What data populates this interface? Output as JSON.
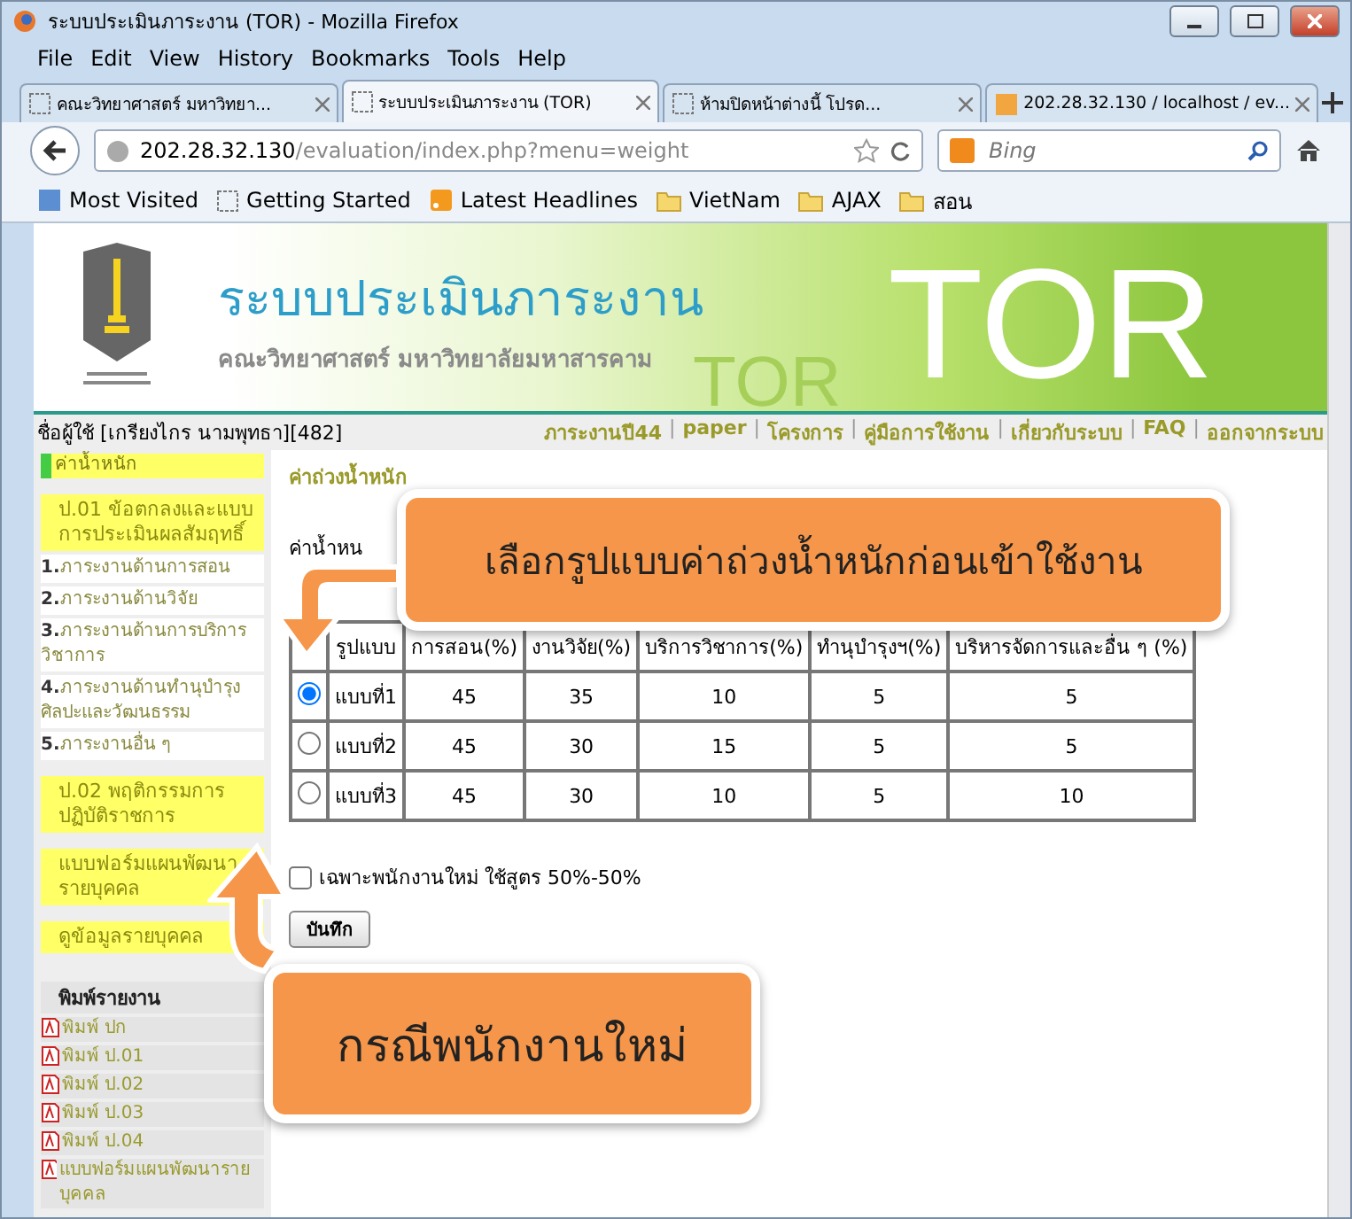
{
  "window": {
    "title": "ระบบประเมินภาระงาน (TOR) - Mozilla Firefox"
  },
  "menu": [
    "File",
    "Edit",
    "View",
    "History",
    "Bookmarks",
    "Tools",
    "Help"
  ],
  "tabs": [
    {
      "label": "คณะวิทยาศาสตร์ มหาวิทยา...",
      "selected": false,
      "kind": "page"
    },
    {
      "label": "ระบบประเมินภาระงาน (TOR)",
      "selected": true,
      "kind": "page"
    },
    {
      "label": "ห้ามปิดหน้าต่างนี้ โปรด...",
      "selected": false,
      "kind": "page"
    },
    {
      "label": "202.28.32.130 / localhost / ev...",
      "selected": false,
      "kind": "pma"
    }
  ],
  "address": {
    "host": "202.28.32.130",
    "path": "/evaluation/index.php?menu=weight"
  },
  "search": {
    "placeholder": "Bing"
  },
  "bookmarks": [
    {
      "label": "Most Visited",
      "kind": "star"
    },
    {
      "label": "Getting Started",
      "kind": "page"
    },
    {
      "label": "Latest Headlines",
      "kind": "feed"
    },
    {
      "label": "VietNam",
      "kind": "folder"
    },
    {
      "label": "AJAX",
      "kind": "folder"
    },
    {
      "label": "สอน",
      "kind": "folder"
    }
  ],
  "banner": {
    "title": "ระบบประเมินภาระงาน",
    "subtitle": "คณะวิทยาศาสตร์ มหาวิทยาลัยมหาสารคาม",
    "faint_text": "TOR",
    "big_text": "TOR"
  },
  "nav_separator": "|",
  "user_label": "ชื่อผู้ใช้ [เกรียงไกร นามพุทธา][482]",
  "nav_links": [
    "ภาระงานปี44",
    "paper",
    "โครงการ",
    "คู่มือการใช้งาน",
    "เกี่ยวกับระบบ",
    "FAQ",
    "ออกจากระบบ"
  ],
  "sidebar": [
    {
      "kind": "active",
      "label": "ค่าน้ำหนัก"
    },
    {
      "kind": "section",
      "label": "ป.01 ข้อตกลงและแบบการประเมินผลสัมฤทธิ์"
    },
    {
      "kind": "item",
      "number": "1.",
      "label": "ภาระงานด้านการสอน"
    },
    {
      "kind": "item",
      "number": "2.",
      "label": "ภาระงานด้านวิจัย"
    },
    {
      "kind": "item",
      "number": "3.",
      "label": "ภาระงานด้านการบริการวิชาการ"
    },
    {
      "kind": "item",
      "number": "4.",
      "label": "ภาระงานด้านทำนุบำรุงศิลปะและวัฒนธรรม"
    },
    {
      "kind": "item",
      "number": "5.",
      "label": "ภาระงานอื่น ๆ"
    },
    {
      "kind": "section",
      "label": "ป.02 พฤติกรรมการปฏิบัติราชการ"
    },
    {
      "kind": "section",
      "label": "แบบฟอร์มแผนพัฒนารายบุคคล"
    },
    {
      "kind": "section",
      "label": "ดูข้อมูลรายบุคคล"
    },
    {
      "kind": "heading",
      "label": "พิมพ์รายงาน"
    },
    {
      "kind": "pdf",
      "label": "พิมพ์ ปก"
    },
    {
      "kind": "pdf",
      "label": "พิมพ์ ป.01"
    },
    {
      "kind": "pdf",
      "label": "พิมพ์ ป.02"
    },
    {
      "kind": "pdf",
      "label": "พิมพ์ ป.03"
    },
    {
      "kind": "pdf",
      "label": "พิมพ์ ป.04"
    },
    {
      "kind": "pdf",
      "label": "แบบฟอร์มแผนพัฒนารายบุคคล"
    }
  ],
  "main": {
    "heading": "ค่าถ่วงน้ำหนัก",
    "note": "ค่าน้ำหน",
    "table": {
      "columns": [
        "รูปแบบ",
        "การสอน(%)",
        "งานวิจัย(%)",
        "บริการวิชาการ(%)",
        "ทำนุบำรุงฯ(%)",
        "บริหารจัดการและอื่น ๆ (%)"
      ],
      "rows": [
        {
          "selected": true,
          "cells": [
            "แบบที่1",
            "45",
            "35",
            "10",
            "5",
            "5"
          ]
        },
        {
          "selected": false,
          "cells": [
            "แบบที่2",
            "45",
            "30",
            "15",
            "5",
            "5"
          ]
        },
        {
          "selected": false,
          "cells": [
            "แบบที่3",
            "45",
            "30",
            "10",
            "5",
            "10"
          ]
        }
      ]
    },
    "checkbox": {
      "label": "เฉพาะพนักงานใหม่ ใช้สูตร 50%-50%",
      "checked": false
    },
    "save_button": "บันทึก"
  },
  "callouts": [
    {
      "text": "เลือกรูปแบบค่าถ่วงน้ำหนักก่อนเข้าใช้งาน",
      "kind": "down"
    },
    {
      "text": "กรณีพนักงานใหม่",
      "kind": "up"
    }
  ]
}
